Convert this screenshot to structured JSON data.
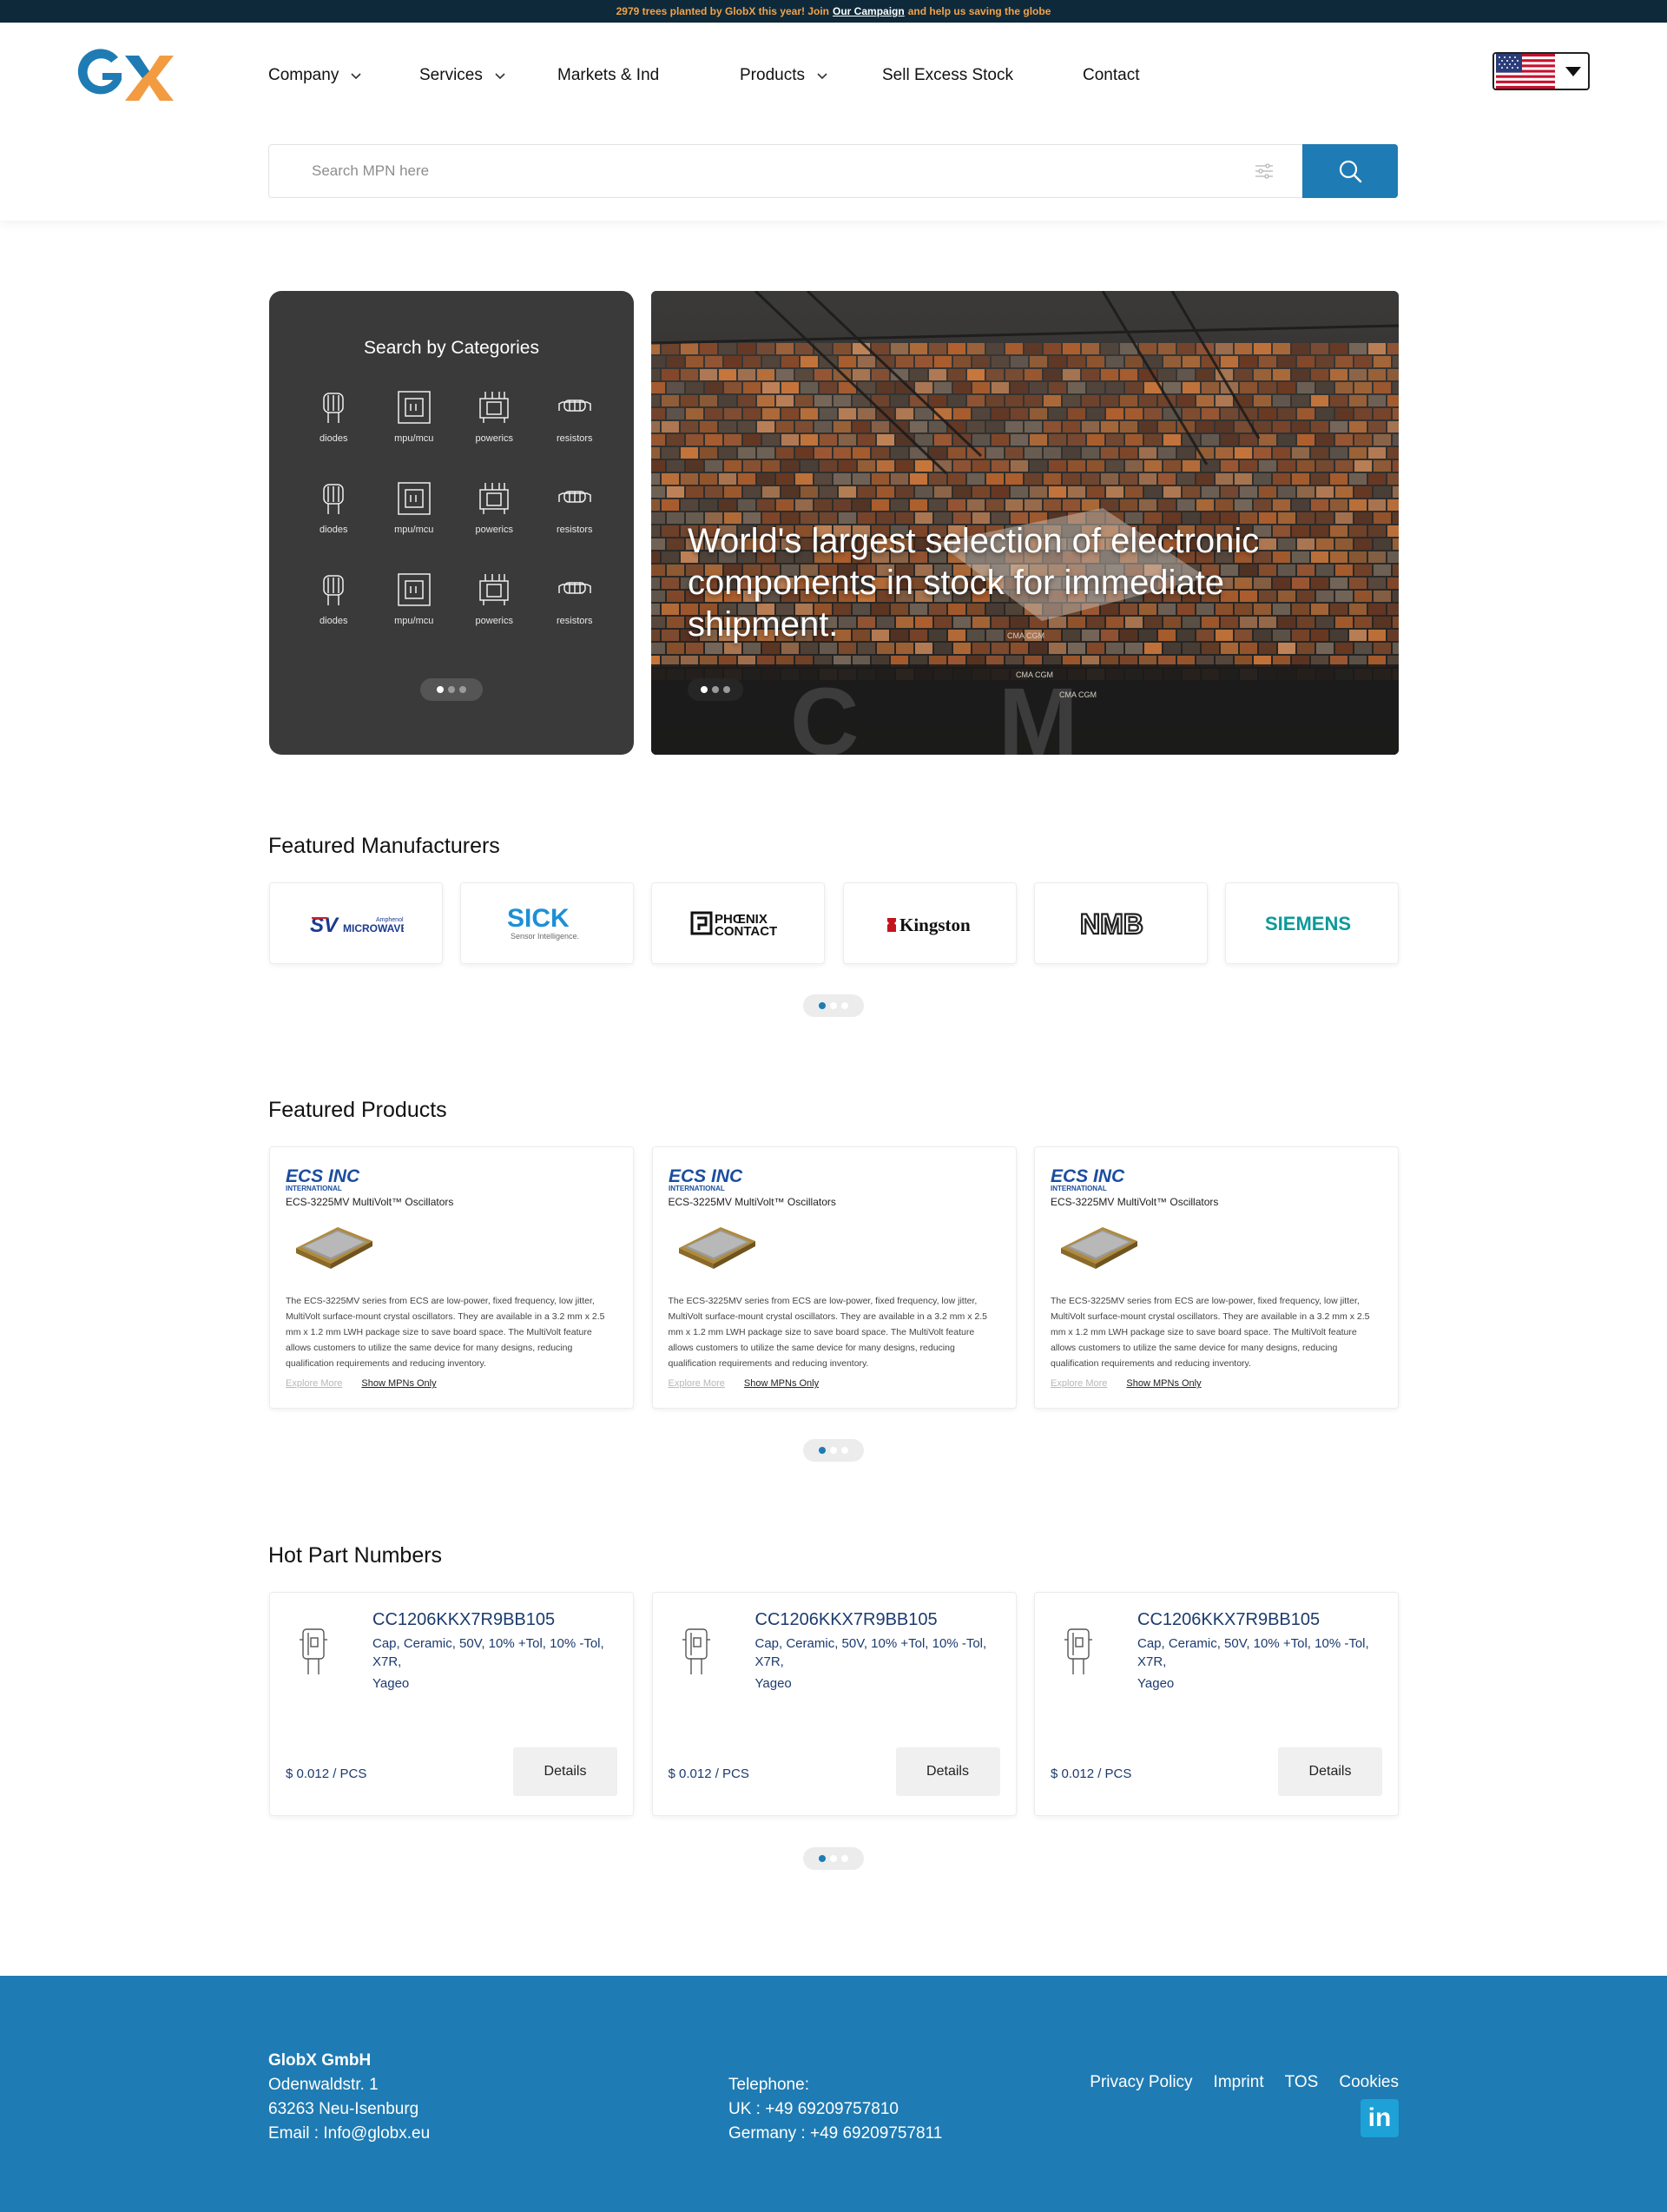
{
  "announcement": {
    "text_before": "2979 trees planted by GlobX this year! Join",
    "link": "Our Campaign",
    "text_after": "and help us saving the globe"
  },
  "header": {
    "logo_alt": "GX",
    "nav": [
      {
        "label": "Company",
        "has_dropdown": true
      },
      {
        "label": "Services",
        "has_dropdown": true
      },
      {
        "label": "Markets & Ind",
        "has_dropdown": false
      },
      {
        "label": "Products",
        "has_dropdown": true
      },
      {
        "label": "Sell Excess Stock",
        "has_dropdown": false
      },
      {
        "label": "Contact",
        "has_dropdown": false
      }
    ],
    "language_flag": "us-flag-icon"
  },
  "search": {
    "placeholder": "Search MPN here",
    "value": ""
  },
  "categories": {
    "title": "Search by Categories",
    "items": [
      {
        "label": "diodes",
        "icon": "diode-icon"
      },
      {
        "label": "mpu/mcu",
        "icon": "mcu-chip-icon"
      },
      {
        "label": "powerics",
        "icon": "power-ic-icon"
      },
      {
        "label": "resistors",
        "icon": "resistor-icon"
      },
      {
        "label": "diodes",
        "icon": "diode-icon"
      },
      {
        "label": "mpu/mcu",
        "icon": "mcu-chip-icon"
      },
      {
        "label": "powerics",
        "icon": "power-ic-icon"
      },
      {
        "label": "resistors",
        "icon": "resistor-icon"
      },
      {
        "label": "diodes",
        "icon": "diode-icon"
      },
      {
        "label": "mpu/mcu",
        "icon": "mcu-chip-icon"
      },
      {
        "label": "powerics",
        "icon": "power-ic-icon"
      },
      {
        "label": "resistors",
        "icon": "resistor-icon"
      }
    ]
  },
  "banner": {
    "headline": "World's largest selection of electronic components in stock for immediate shipment.",
    "container_lettering": [
      "CMA CGM",
      "CMA CGM",
      "CMA CGM",
      "C",
      "M"
    ]
  },
  "featured_manufacturers": {
    "title": "Featured Manufacturers",
    "items": [
      {
        "name": "SV Microwave",
        "logo_text": "SV",
        "logo_sub": "MICROWAVE",
        "logo_tag": "Amphenol"
      },
      {
        "name": "SICK",
        "logo_text": "SICK",
        "logo_sub": "Sensor Intelligence."
      },
      {
        "name": "Phoenix Contact",
        "logo_text": "PHŒNIX",
        "logo_sub": "CONTACT"
      },
      {
        "name": "Kingston",
        "logo_text": "Kingston"
      },
      {
        "name": "NMB",
        "logo_text": "NMB"
      },
      {
        "name": "Siemens",
        "logo_text": "SIEMENS"
      }
    ]
  },
  "featured_products": {
    "title": "Featured Products",
    "items": [
      {
        "brand": "ECS INC",
        "brand_sub": "INTERNATIONAL",
        "name": "ECS-3225MV MultiVolt™ Oscillators",
        "description": "The ECS-3225MV series from ECS are low-power, fixed frequency, low jitter, MultiVolt surface-mount crystal oscillators. They are available in a 3.2 mm x 2.5 mm x 1.2 mm LWH package size to save board space. The MultiVolt feature allows customers to utilize the same device for many designs, reducing qualification requirements and reducing inventory.",
        "explore_label": "Explore More",
        "mpn_label": "Show MPNs Only"
      },
      {
        "brand": "ECS INC",
        "brand_sub": "INTERNATIONAL",
        "name": "ECS-3225MV MultiVolt™ Oscillators",
        "description": "The ECS-3225MV series from ECS are low-power, fixed frequency, low jitter, MultiVolt surface-mount crystal oscillators. They are available in a 3.2 mm x 2.5 mm x 1.2 mm LWH package size to save board space. The MultiVolt feature allows customers to utilize the same device for many designs, reducing qualification requirements and reducing inventory.",
        "explore_label": "Explore More",
        "mpn_label": "Show MPNs Only"
      },
      {
        "brand": "ECS INC",
        "brand_sub": "INTERNATIONAL",
        "name": "ECS-3225MV MultiVolt™ Oscillators",
        "description": "The ECS-3225MV series from ECS are low-power, fixed frequency, low jitter, MultiVolt surface-mount crystal oscillators. They are available in a 3.2 mm x 2.5 mm x 1.2 mm LWH package size to save board space. The MultiVolt feature allows customers to utilize the same device for many designs, reducing qualification requirements and reducing inventory.",
        "explore_label": "Explore More",
        "mpn_label": "Show MPNs Only"
      }
    ]
  },
  "hot_parts": {
    "title": "Hot Part Numbers",
    "items": [
      {
        "mpn": "CC1206KKX7R9BB105",
        "description": "Cap, Ceramic, 50V, 10% +Tol, 10% -Tol, X7R,",
        "manufacturer": "Yageo",
        "price": "$ 0.012 / PCS",
        "button": "Details"
      },
      {
        "mpn": "CC1206KKX7R9BB105",
        "description": "Cap, Ceramic, 50V, 10% +Tol, 10% -Tol, X7R,",
        "manufacturer": "Yageo",
        "price": "$ 0.012 / PCS",
        "button": "Details"
      },
      {
        "mpn": "CC1206KKX7R9BB105",
        "description": "Cap, Ceramic, 50V, 10% +Tol, 10% -Tol, X7R,",
        "manufacturer": "Yageo",
        "price": "$ 0.012 / PCS",
        "button": "Details"
      }
    ]
  },
  "footer": {
    "company": "GlobX GmbH",
    "street": "Odenwaldstr. 1",
    "city": "63263 Neu-Isenburg",
    "email": "Email : Info@globx.eu",
    "phone_label": "Telephone:",
    "phone_uk": "UK : +49 69209757810",
    "phone_de": "Germany : +49 69209757811",
    "links": [
      "Privacy Policy",
      "Imprint",
      "TOS",
      "Cookies"
    ],
    "social": "linkedin-icon",
    "social_text": "in"
  },
  "colors": {
    "primary": "#1f7bb3",
    "topbar_bg": "#0e2a3a",
    "topbar_text": "#f2a24b",
    "category_panel": "#3a3a3a",
    "part_text": "#1b3b6f"
  }
}
